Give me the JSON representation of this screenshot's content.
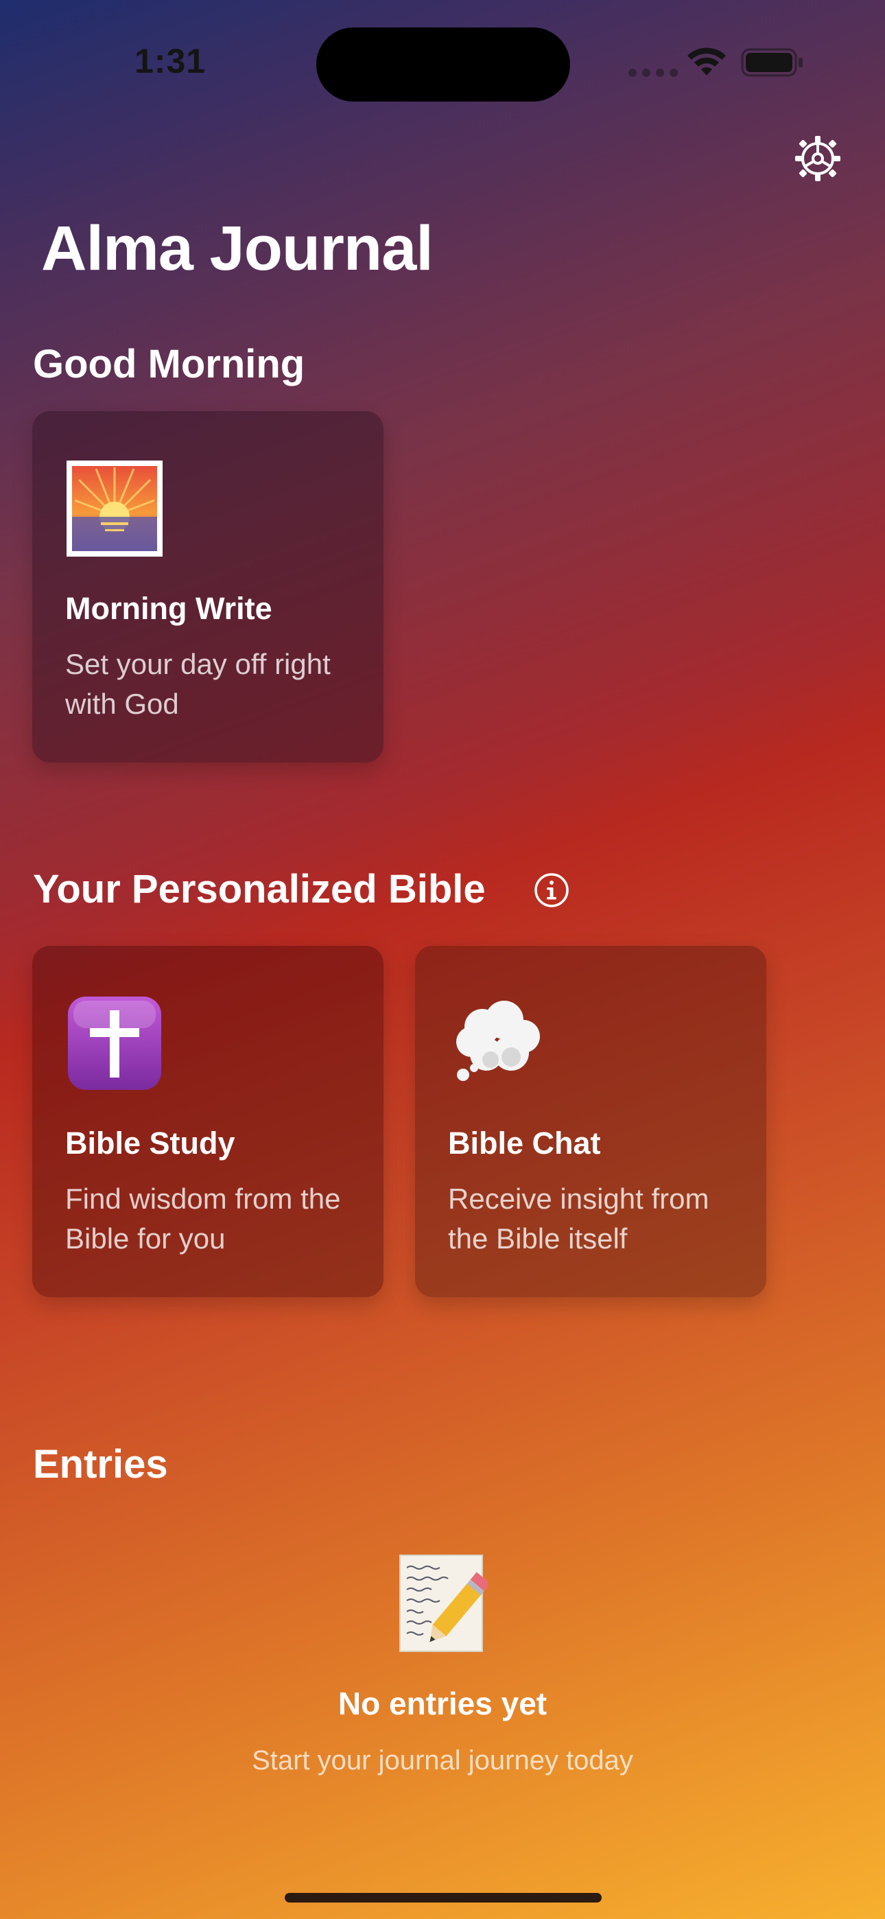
{
  "status_bar": {
    "time": "1:31"
  },
  "header": {
    "app_title": "Alma Journal"
  },
  "sections": {
    "morning": {
      "title": "Good Morning",
      "cards": [
        {
          "title": "Morning Write",
          "subtitle": "Set your day off right with God",
          "icon": "sunrise-icon"
        }
      ]
    },
    "bible": {
      "title": "Your Personalized Bible",
      "cards": [
        {
          "title": "Bible Study",
          "subtitle": "Find wisdom from the Bible for you",
          "icon": "cross-icon"
        },
        {
          "title": "Bible Chat",
          "subtitle": "Receive insight from the Bible itself",
          "icon": "thought-bubble-icon"
        }
      ]
    },
    "entries": {
      "title": "Entries",
      "empty_title": "No entries yet",
      "empty_subtitle": "Start your journal journey today"
    }
  },
  "icons": [
    "settings-gear-icon",
    "info-icon",
    "wifi-icon",
    "battery-icon",
    "memo-pencil-icon"
  ],
  "colors": {
    "gradient_top": "#1f2d6e",
    "gradient_mid": "#b8291f",
    "gradient_bottom": "#f7b02e"
  }
}
